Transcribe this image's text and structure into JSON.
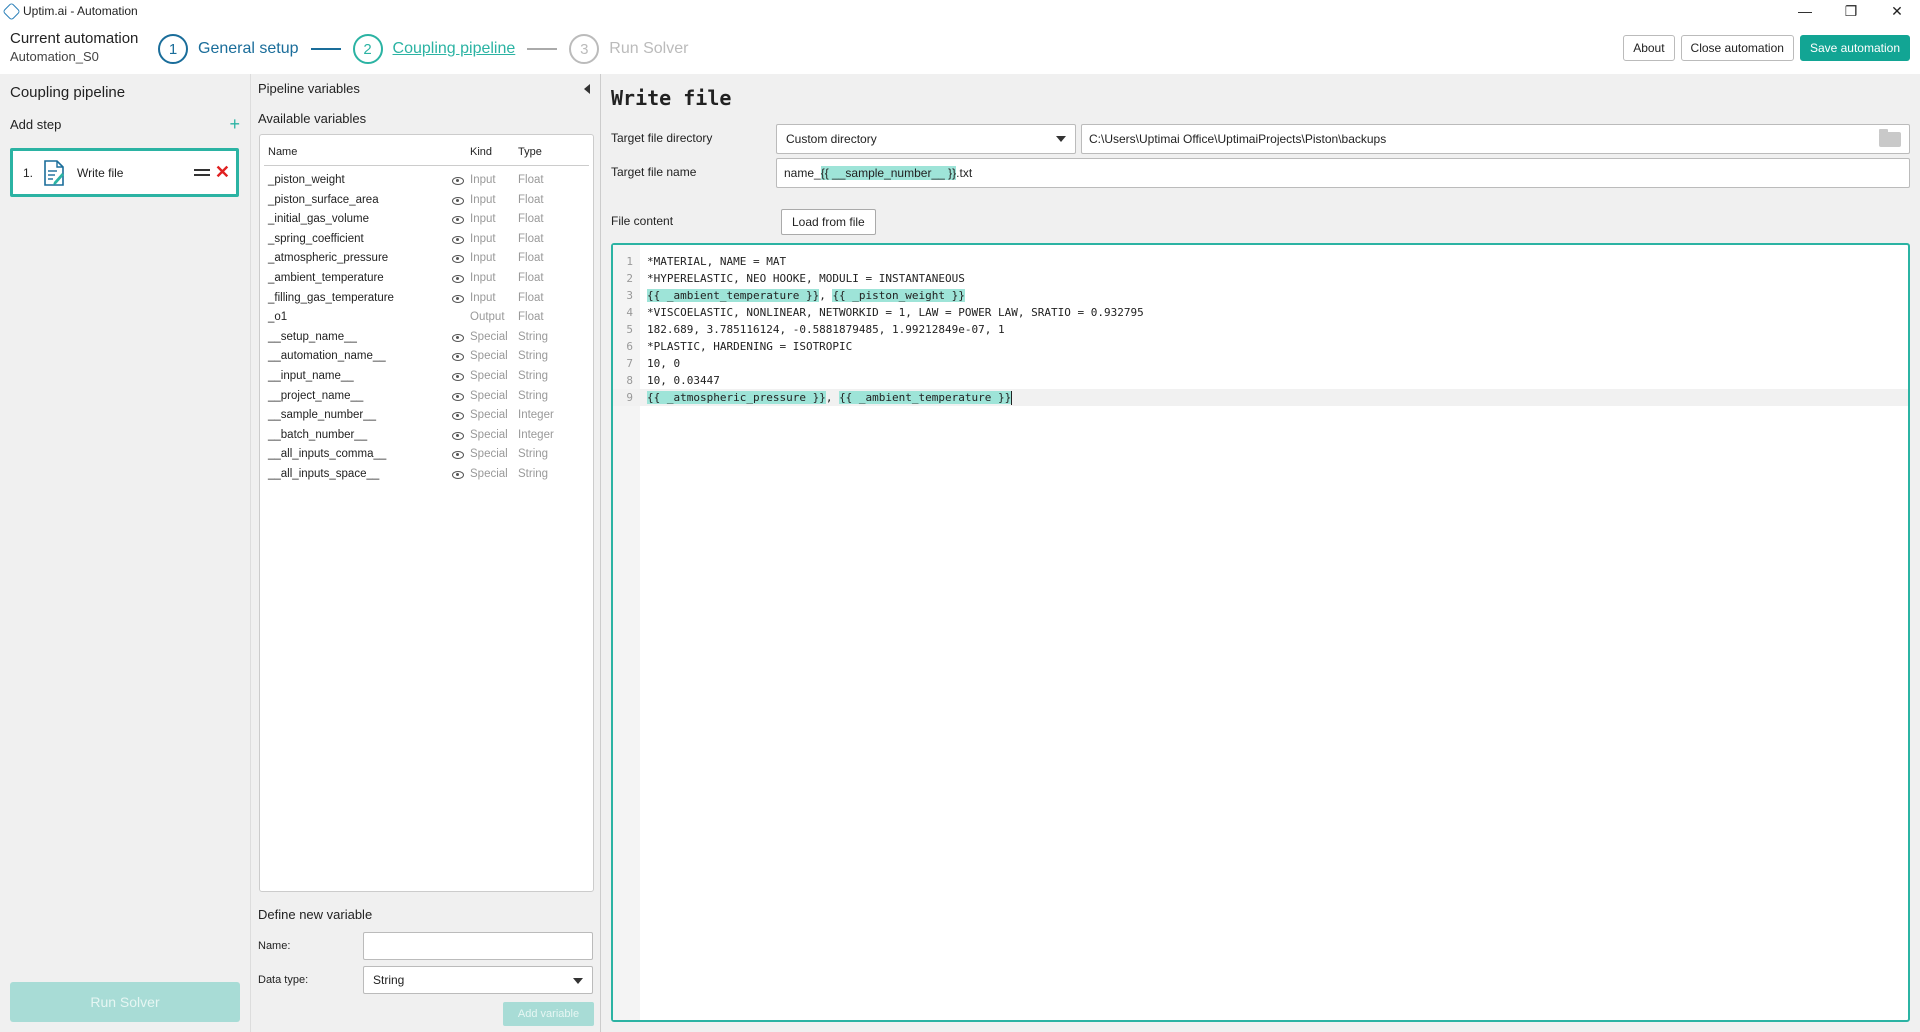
{
  "window": {
    "title": "Uptim.ai - Automation",
    "controls": {
      "minimize": "—",
      "maximize": "❐",
      "close": "✕"
    }
  },
  "header": {
    "current_automation_label": "Current automation",
    "automation_name": "Automation_S0",
    "steps": [
      {
        "number": "1",
        "label": "General setup",
        "state": "done"
      },
      {
        "number": "2",
        "label": "Coupling pipeline",
        "state": "active"
      },
      {
        "number": "3",
        "label": "Run Solver",
        "state": "disabled"
      }
    ],
    "buttons": {
      "about": "About",
      "close": "Close automation",
      "save": "Save automation"
    }
  },
  "left_panel": {
    "title": "Coupling pipeline",
    "add_step_label": "Add step",
    "add_icon": "+",
    "steps": [
      {
        "number": "1.",
        "name": "Write file"
      }
    ],
    "delete_icon": "✕",
    "run_solver_label": "Run Solver"
  },
  "variables_panel": {
    "title": "Pipeline variables",
    "available_label": "Available variables",
    "columns": {
      "name": "Name",
      "kind": "Kind",
      "type": "Type"
    },
    "variables": [
      {
        "name": "_piston_weight",
        "kind": "Input",
        "type": "Float",
        "visible": true
      },
      {
        "name": "_piston_surface_area",
        "kind": "Input",
        "type": "Float",
        "visible": true
      },
      {
        "name": "_initial_gas_volume",
        "kind": "Input",
        "type": "Float",
        "visible": true
      },
      {
        "name": "_spring_coefficient",
        "kind": "Input",
        "type": "Float",
        "visible": true
      },
      {
        "name": "_atmospheric_pressure",
        "kind": "Input",
        "type": "Float",
        "visible": true
      },
      {
        "name": "_ambient_temperature",
        "kind": "Input",
        "type": "Float",
        "visible": true
      },
      {
        "name": "_filling_gas_temperature",
        "kind": "Input",
        "type": "Float",
        "visible": true
      },
      {
        "name": "_o1",
        "kind": "Output",
        "type": "Float",
        "visible": false
      },
      {
        "name": "__setup_name__",
        "kind": "Special",
        "type": "String",
        "visible": true
      },
      {
        "name": "__automation_name__",
        "kind": "Special",
        "type": "String",
        "visible": true
      },
      {
        "name": "__input_name__",
        "kind": "Special",
        "type": "String",
        "visible": true
      },
      {
        "name": "__project_name__",
        "kind": "Special",
        "type": "String",
        "visible": true
      },
      {
        "name": "__sample_number__",
        "kind": "Special",
        "type": "Integer",
        "visible": true
      },
      {
        "name": "__batch_number__",
        "kind": "Special",
        "type": "Integer",
        "visible": true
      },
      {
        "name": "__all_inputs_comma__",
        "kind": "Special",
        "type": "String",
        "visible": true
      },
      {
        "name": "__all_inputs_space__",
        "kind": "Special",
        "type": "String",
        "visible": true
      }
    ],
    "define_new_label": "Define new variable",
    "name_label": "Name:",
    "name_value": "",
    "data_type_label": "Data type:",
    "data_type_value": "String",
    "add_variable_label": "Add variable"
  },
  "write_file": {
    "title": "Write file",
    "target_dir_label": "Target file directory",
    "target_dir_mode": "Custom directory",
    "target_dir_path": "C:\\Users\\Uptimai Office\\UptimaiProjects\\Piston\\backups",
    "target_name_label": "Target file name",
    "target_name_prefix": "name_",
    "target_name_var": "{{ __sample_number__ }}",
    "target_name_suffix": ".txt",
    "file_content_label": "File content",
    "load_from_file_label": "Load from file",
    "content_lines": [
      {
        "n": "1",
        "text": "*MATERIAL, NAME = MAT"
      },
      {
        "n": "2",
        "text": "*HYPERELASTIC, NEO HOOKE, MODULI = INSTANTANEOUS"
      },
      {
        "n": "3",
        "parts": [
          {
            "text": "{{ _ambient_temperature }}",
            "hl": true
          },
          {
            "text": ", ",
            "hl": false
          },
          {
            "text": "{{ _piston_weight }}",
            "hl": true
          }
        ]
      },
      {
        "n": "4",
        "text": "*VISCOELASTIC, NONLINEAR, NETWORKID = 1, LAW = POWER LAW, SRATIO = 0.932795"
      },
      {
        "n": "5",
        "text": "182.689, 3.785116124, -0.5881879485, 1.99212849e-07, 1"
      },
      {
        "n": "6",
        "text": "*PLASTIC, HARDENING = ISOTROPIC"
      },
      {
        "n": "7",
        "text": "10, 0"
      },
      {
        "n": "8",
        "text": "10, 0.03447"
      },
      {
        "n": "9",
        "parts": [
          {
            "text": "{{ _atmospheric_pressure }}",
            "hl": true
          },
          {
            "text": ", ",
            "hl": false
          },
          {
            "text": "{{ _ambient_temperature }}",
            "hl": true
          }
        ],
        "current": true
      }
    ]
  },
  "colors": {
    "accent": "#2bb3a3",
    "primary_button": "#12a594",
    "step_done": "#1a6d9a",
    "highlight": "#9ee4d8",
    "delete": "#e02020"
  }
}
